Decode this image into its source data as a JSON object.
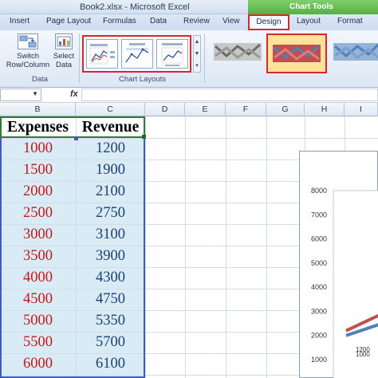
{
  "window": {
    "title": "Book2.xlsx - Microsoft Excel",
    "context_label": "Chart Tools"
  },
  "tabs": [
    "Insert",
    "Page Layout",
    "Formulas",
    "Data",
    "Review",
    "View",
    "Design",
    "Layout",
    "Format"
  ],
  "ribbon": {
    "switch_label_1": "Switch",
    "switch_label_2": "Row/Column",
    "select_label_1": "Select",
    "select_label_2": "Data",
    "data_group": "Data",
    "layouts_group": "Chart Layouts"
  },
  "formula_bar": {
    "fx": "fx",
    "value": ""
  },
  "columns": [
    "B",
    "C",
    "D",
    "E",
    "F",
    "G",
    "H",
    "I"
  ],
  "table": {
    "headers": [
      "Expenses",
      "Revenue"
    ],
    "rows": [
      [
        "1000",
        "1200"
      ],
      [
        "1500",
        "1900"
      ],
      [
        "2000",
        "2100"
      ],
      [
        "2500",
        "2750"
      ],
      [
        "3000",
        "3100"
      ],
      [
        "3500",
        "3900"
      ],
      [
        "4000",
        "4300"
      ],
      [
        "4500",
        "4750"
      ],
      [
        "5000",
        "5350"
      ],
      [
        "5500",
        "5700"
      ],
      [
        "6000",
        "6100"
      ]
    ]
  },
  "chart_data": {
    "type": "line",
    "y_ticks": [
      "8000",
      "7000",
      "6000",
      "5000",
      "4000",
      "3000",
      "2000",
      "1000"
    ],
    "ylim": [
      0,
      8000
    ],
    "data_labels": [
      "1200",
      "1000"
    ],
    "series": [
      {
        "values": [
          1200,
          1900,
          2100,
          2750,
          3100,
          3900,
          4300,
          4750,
          5350,
          5700,
          6100
        ]
      },
      {
        "values": [
          1000,
          1500,
          2000,
          2500,
          3000,
          3500,
          4000,
          4500,
          5000,
          5500,
          6000
        ]
      }
    ]
  },
  "colors": {
    "expenses_text": "#c3171b",
    "revenue_text": "#1d3f73",
    "highlight_red": "#d8262c",
    "chart_red": "#c0504d",
    "chart_blue": "#4f81bd"
  }
}
